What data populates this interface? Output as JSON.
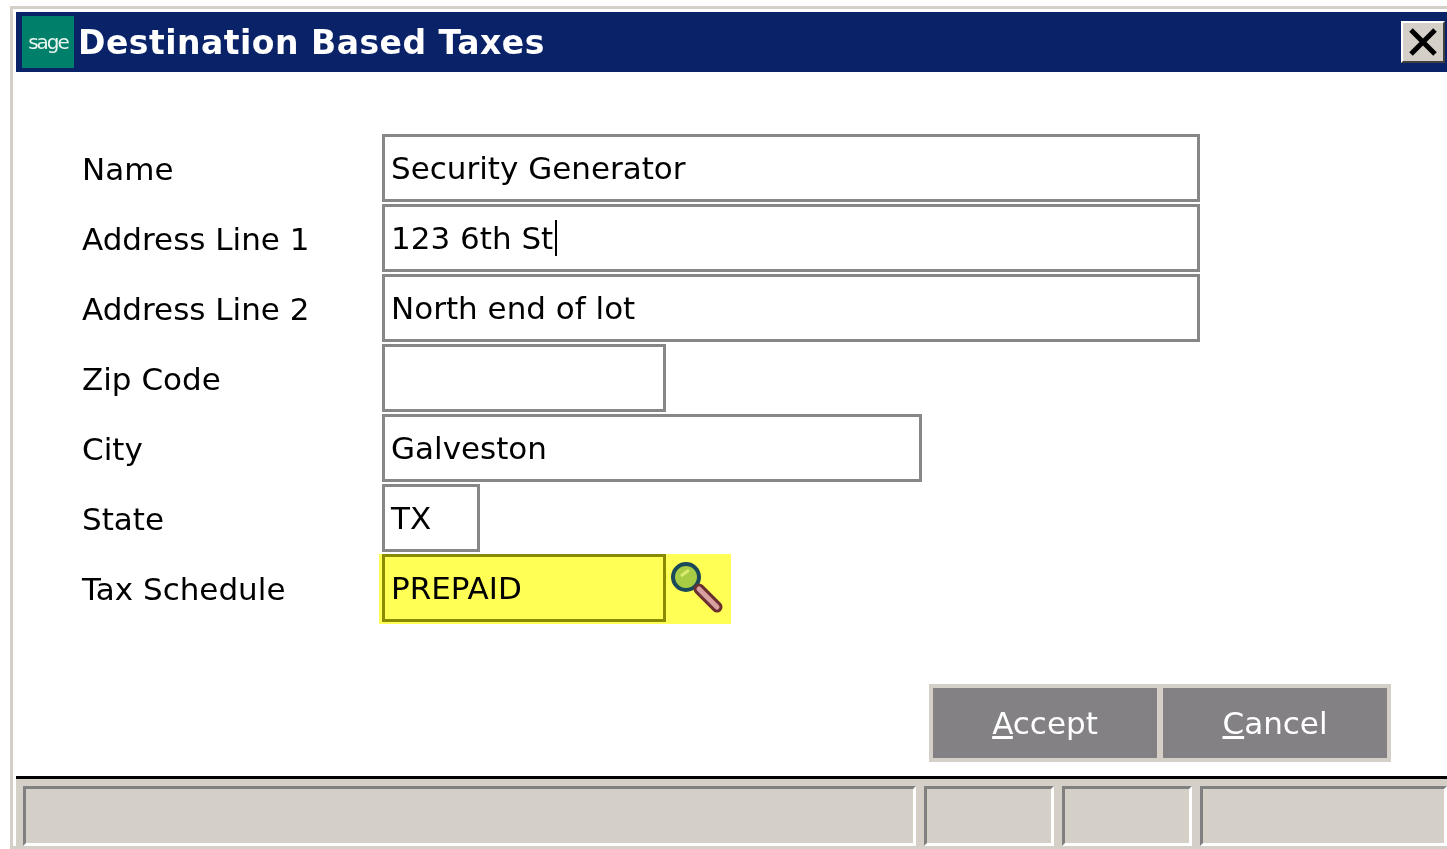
{
  "window": {
    "logo_text": "sage",
    "title": "Destination Based Taxes"
  },
  "fields": [
    {
      "label": "Name",
      "value": "Security Generator",
      "focused": false,
      "caret": false
    },
    {
      "label": "Address Line 1",
      "value": "123 6th St",
      "focused": false,
      "caret": true
    },
    {
      "label": "Address Line 2",
      "value": "North end of lot",
      "focused": false,
      "caret": false
    },
    {
      "label": "Zip Code",
      "focused": false,
      "caret": false
    },
    {
      "label": "City",
      "value": "Galveston",
      "focused": false,
      "caret": false
    },
    {
      "label": "State",
      "value": "TX",
      "focused": false,
      "caret": false
    },
    {
      "label": "Tax Schedule",
      "value": "PREPAID",
      "focused": true,
      "caret": false,
      "kind": "lookup"
    }
  ],
  "buttons": [
    {
      "key": "A",
      "rest": "ccept"
    },
    {
      "key": "C",
      "rest": "ancel"
    }
  ]
}
